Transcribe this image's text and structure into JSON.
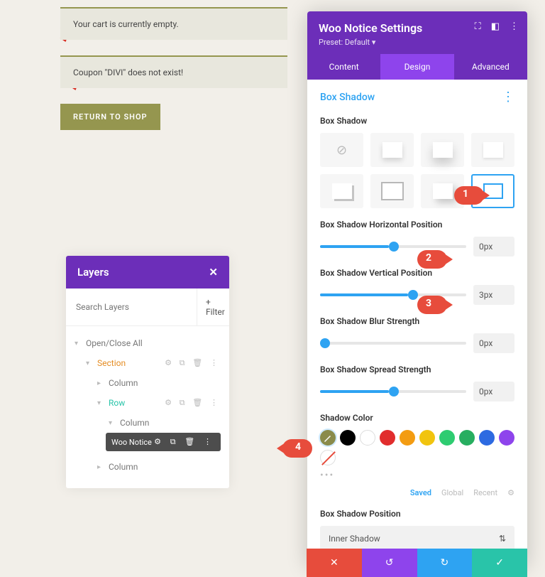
{
  "notices": {
    "empty_cart": "Your cart is currently empty.",
    "coupon": "Coupon \"DIVI\" does not exist!",
    "return_btn": "RETURN TO SHOP"
  },
  "layers": {
    "title": "Layers",
    "search_placeholder": "Search Layers",
    "filter": "+ Filter",
    "open_close": "Open/Close All",
    "section": "Section",
    "column": "Column",
    "row": "Row",
    "woo_notice": "Woo Notice"
  },
  "settings": {
    "title": "Woo Notice Settings",
    "preset": "Preset: Default",
    "tabs": {
      "content": "Content",
      "design": "Design",
      "advanced": "Advanced"
    },
    "section": "Box Shadow",
    "labels": {
      "box_shadow": "Box Shadow",
      "hpos": "Box Shadow Horizontal Position",
      "vpos": "Box Shadow Vertical Position",
      "blur": "Box Shadow Blur Strength",
      "spread": "Box Shadow Spread Strength",
      "color": "Shadow Color",
      "position": "Box Shadow Position"
    },
    "values": {
      "hpos": "0px",
      "vpos": "3px",
      "blur": "0px",
      "spread": "0px"
    },
    "swatch_tabs": {
      "saved": "Saved",
      "global": "Global",
      "recent": "Recent"
    },
    "position_value": "Inner Shadow"
  },
  "callouts": {
    "c1": "1",
    "c2": "2",
    "c3": "3",
    "c4": "4"
  },
  "colors": {
    "picked": "#8a8b4a",
    "palette": [
      "#000000",
      "#ffffff",
      "#e12d2d",
      "#f39c12",
      "#f1c40f",
      "#2ecc71",
      "#27ae60",
      "#2d6ae1",
      "#8e44ec"
    ]
  }
}
